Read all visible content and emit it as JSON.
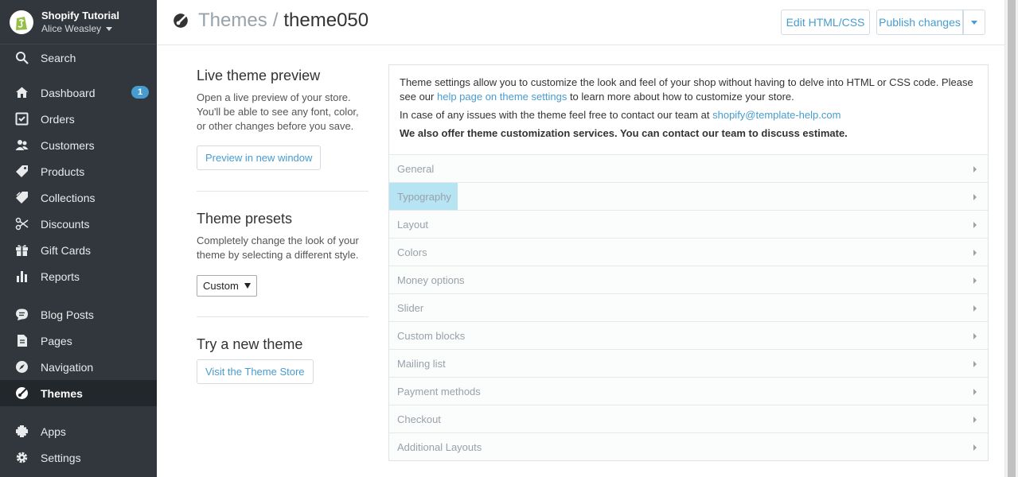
{
  "sidebar": {
    "store_name": "Shopify Tutorial",
    "store_user": "Alice Weasley",
    "search_label": "Search",
    "items": [
      {
        "label": "Dashboard",
        "icon": "home-icon",
        "badge": "1"
      },
      {
        "label": "Orders",
        "icon": "orders-icon"
      },
      {
        "label": "Customers",
        "icon": "customers-icon"
      },
      {
        "label": "Products",
        "icon": "tag-icon"
      },
      {
        "label": "Collections",
        "icon": "collections-icon"
      },
      {
        "label": "Discounts",
        "icon": "discounts-icon"
      },
      {
        "label": "Gift Cards",
        "icon": "gift-icon"
      },
      {
        "label": "Reports",
        "icon": "reports-icon"
      },
      {
        "label": "Blog Posts",
        "icon": "blog-icon"
      },
      {
        "label": "Pages",
        "icon": "pages-icon"
      },
      {
        "label": "Navigation",
        "icon": "navigation-icon"
      },
      {
        "label": "Themes",
        "icon": "themes-icon",
        "active": true
      },
      {
        "label": "Apps",
        "icon": "apps-icon"
      },
      {
        "label": "Settings",
        "icon": "gear-icon"
      }
    ]
  },
  "header": {
    "crumb": "Themes",
    "separator": "/",
    "title": "theme050",
    "edit_button": "Edit HTML/CSS",
    "publish_button": "Publish changes"
  },
  "left": {
    "preview_title": "Live theme preview",
    "preview_text": "Open a live preview of your store. You'll be able to see any font, color, or other changes before you save.",
    "preview_button": "Preview in new window",
    "presets_title": "Theme presets",
    "presets_text": "Completely change the look of your theme by selecting a different style.",
    "presets_value": "Custom",
    "new_title": "Try a new theme",
    "new_button": "Visit the Theme Store"
  },
  "panel": {
    "info_1a": "Theme settings allow you to customize the look and feel of your shop without having to delve into HTML or CSS code. Please see our ",
    "info_1_link": "help page on theme settings",
    "info_1b": " to learn more about how to customize your store.",
    "info_2a": "In case of any issues with the theme feel free to contact our team at ",
    "info_2_link": "shopify@template-help.com",
    "info_3": "We also offer theme customization services. You can contact our team to discuss estimate.",
    "sections": [
      "General",
      "Typography",
      "Layout",
      "Colors",
      "Money options",
      "Slider",
      "Custom blocks",
      "Mailing list",
      "Payment methods",
      "Checkout",
      "Additional Layouts"
    ]
  }
}
